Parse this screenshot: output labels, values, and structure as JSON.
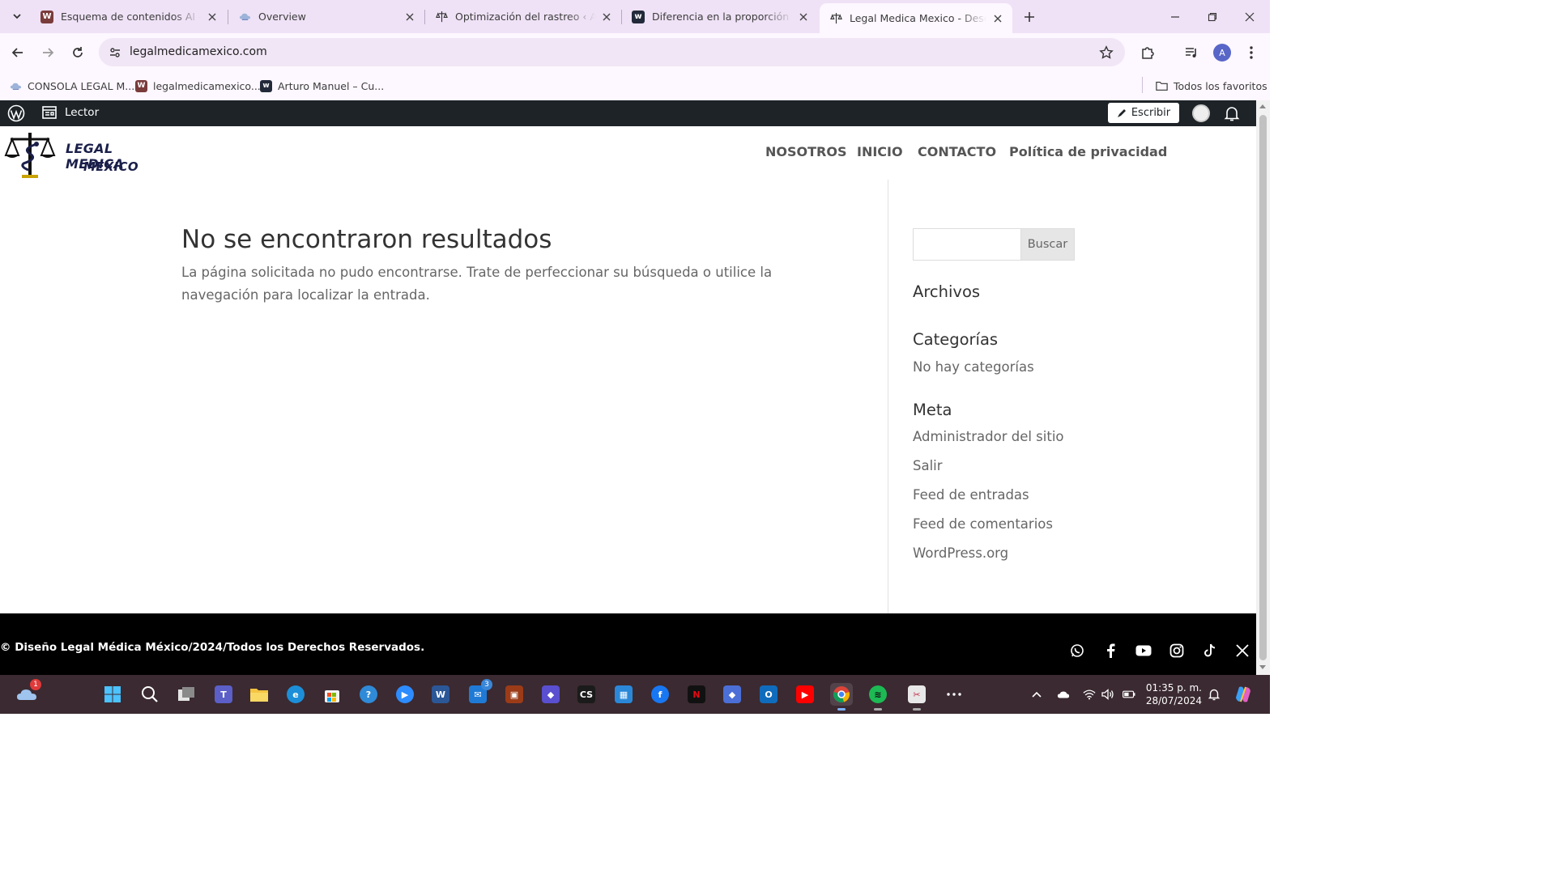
{
  "browser": {
    "tabs": [
      {
        "title": "Esquema de contenidos AI - Wi",
        "favicon": "w-icon"
      },
      {
        "title": "Overview",
        "favicon": "cloud-icon"
      },
      {
        "title": "Optimización del rastreo ‹ Ajust",
        "favicon": "caduceus-icon"
      },
      {
        "title": "Diferencia en la proporción de l",
        "favicon": "w-dark-icon"
      },
      {
        "title": "Legal Medica Mexico - Descubr",
        "favicon": "caduceus-icon",
        "active": true
      }
    ],
    "url": "legalmedicamexico.com",
    "profile_initial": "A",
    "bookmarks": [
      {
        "label": "CONSOLA LEGAL M...",
        "favicon": "cloud-icon"
      },
      {
        "label": "legalmedicamexico....",
        "favicon": "w-icon"
      },
      {
        "label": "Arturo Manuel – Cu...",
        "favicon": "w-dark-icon"
      }
    ],
    "all_bookmarks_label": "Todos los favoritos"
  },
  "adminbar": {
    "reader_label": "Lector",
    "write_label": "Escribir"
  },
  "site": {
    "logo_line1": "LEGAL MEDICA",
    "logo_line2": "MÉXICO",
    "nav": [
      "NOSOTROS",
      "INICIO",
      "CONTACTO",
      "Política de privacidad"
    ]
  },
  "content": {
    "title": "No se encontraron resultados",
    "text": "La página solicitada no pudo encontrarse. Trate de perfeccionar su búsqueda o utilice la navegación para localizar la entrada."
  },
  "sidebar": {
    "search_button": "Buscar",
    "archives_title": "Archivos",
    "categories_title": "Categorías",
    "no_categories": "No hay categorías",
    "meta_title": "Meta",
    "meta_links": [
      "Administrador del sitio",
      "Salir",
      "Feed de entradas",
      "Feed de comentarios",
      "WordPress.org"
    ]
  },
  "footer": {
    "copyright": "© Diseño Legal Médica México/2024/Todos los Derechos Reservados.",
    "social": [
      "whatsapp-icon",
      "facebook-icon",
      "youtube-icon",
      "instagram-icon",
      "tiktok-icon",
      "x-icon"
    ]
  },
  "taskbar": {
    "weather_badge": "1",
    "mail_badge": "3",
    "time": "01:35 p. m.",
    "date": "28/07/2024",
    "colors": {
      "accent": "#3b2a31"
    }
  }
}
